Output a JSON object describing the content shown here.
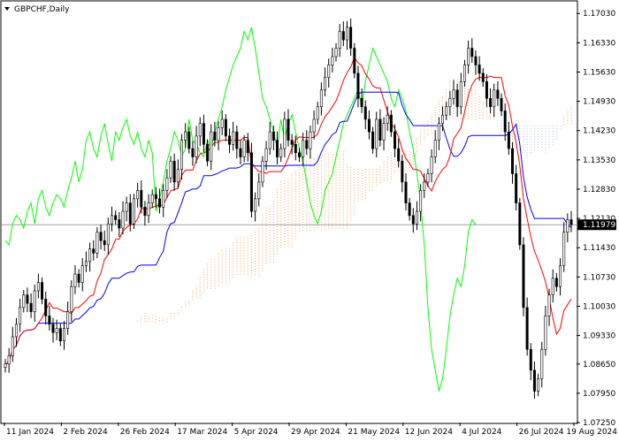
{
  "window": {
    "title": "GBPCHF,Daily"
  },
  "colors": {
    "background": "#ffffff",
    "candle": "#000000",
    "tenkan": "#ff0000",
    "kijun": "#0000ff",
    "chikou": "#00ff00",
    "cloud_bullish": "#f4a460",
    "cloud_bearish": "#b0c4ff",
    "current_price_line": "#a0a0a0",
    "price_box_bg": "#000000"
  },
  "chart_data": {
    "type": "candlestick",
    "symbol": "GBPCHF",
    "timeframe": "Daily",
    "indicator": "Ichimoku Kinko Hyo",
    "current_price": 1.11979,
    "current_price_label": "1.11979",
    "ylim": [
      1.0725,
      1.1731
    ],
    "y_ticks": [
      "1.17030",
      "1.16330",
      "1.15630",
      "1.14930",
      "1.14230",
      "1.13530",
      "1.12830",
      "1.12130",
      "1.11430",
      "1.10730",
      "1.10030",
      "1.09330",
      "1.08650",
      "1.07950",
      "1.07250"
    ],
    "x_ticks": [
      "11 Jan 2024",
      "2 Feb 2024",
      "26 Feb 2024",
      "17 Mar 2024",
      "5 Apr 2024",
      "29 Apr 2024",
      "21 May 2024",
      "12 Jun 2024",
      "4 Jul 2024",
      "26 Jul 2024",
      "19 Aug 2024"
    ],
    "closes": [
      1.0865,
      1.0885,
      1.093,
      1.096,
      1.1,
      1.103,
      1.101,
      1.099,
      1.104,
      1.106,
      1.102,
      1.098,
      1.096,
      1.094,
      1.095,
      1.092,
      1.095,
      1.099,
      1.105,
      1.108,
      1.106,
      1.11,
      1.111,
      1.114,
      1.113,
      1.118,
      1.116,
      1.115,
      1.12,
      1.122,
      1.121,
      1.119,
      1.123,
      1.125,
      1.12,
      1.126,
      1.128,
      1.124,
      1.122,
      1.125,
      1.127,
      1.126,
      1.124,
      1.128,
      1.131,
      1.135,
      1.13,
      1.133,
      1.14,
      1.142,
      1.138,
      1.136,
      1.141,
      1.144,
      1.139,
      1.135,
      1.142,
      1.14,
      1.143,
      1.145,
      1.141,
      1.139,
      1.142,
      1.138,
      1.136,
      1.14,
      1.137,
      1.123,
      1.126,
      1.13,
      1.135,
      1.138,
      1.142,
      1.14,
      1.136,
      1.138,
      1.145,
      1.14,
      1.139,
      1.137,
      1.136,
      1.14,
      1.138,
      1.142,
      1.145,
      1.148,
      1.152,
      1.155,
      1.158,
      1.16,
      1.162,
      1.166,
      1.164,
      1.167,
      1.162,
      1.156,
      1.15,
      1.148,
      1.145,
      1.142,
      1.138,
      1.145,
      1.14,
      1.144,
      1.146,
      1.142,
      1.138,
      1.135,
      1.13,
      1.125,
      1.122,
      1.12,
      1.123,
      1.128,
      1.13,
      1.132,
      1.136,
      1.14,
      1.144,
      1.146,
      1.148,
      1.15,
      1.152,
      1.148,
      1.154,
      1.158,
      1.162,
      1.16,
      1.158,
      1.156,
      1.154,
      1.15,
      1.148,
      1.152,
      1.15,
      1.147,
      1.142,
      1.138,
      1.132,
      1.125,
      1.115,
      1.1,
      1.09,
      1.085,
      1.08,
      1.083,
      1.09,
      1.098,
      1.103,
      1.107,
      1.105,
      1.11,
      1.118,
      1.121,
      1.1198
    ]
  }
}
